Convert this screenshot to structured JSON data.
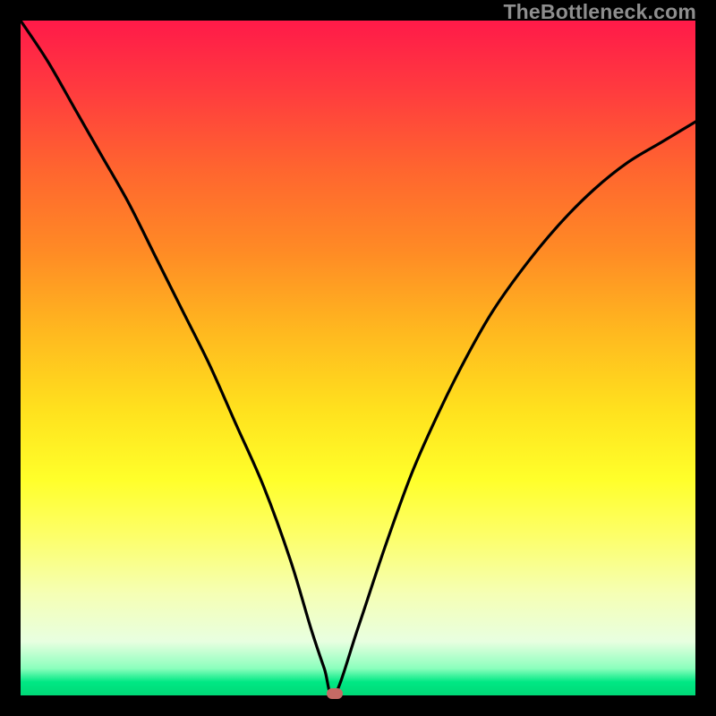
{
  "watermark": "TheBottleneck.com",
  "colors": {
    "frame": "#000000",
    "gradient_top": "#ff1a49",
    "gradient_bottom": "#00d877",
    "curve": "#000000",
    "marker": "#c56a65",
    "watermark": "#8e8e8e"
  },
  "chart_data": {
    "type": "line",
    "title": "",
    "xlabel": "",
    "ylabel": "",
    "xlim": [
      0,
      100
    ],
    "ylim": [
      0,
      100
    ],
    "grid": false,
    "legend": false,
    "series": [
      {
        "name": "bottleneck-curve",
        "x": [
          0,
          4,
          8,
          12,
          16,
          20,
          24,
          28,
          32,
          36,
          40,
          43,
          45,
          46.5,
          50,
          54,
          58,
          62,
          66,
          70,
          75,
          80,
          85,
          90,
          95,
          100
        ],
        "values": [
          100,
          94,
          87,
          80,
          73,
          65,
          57,
          49,
          40,
          31,
          20,
          10,
          4,
          0,
          10,
          22,
          33,
          42,
          50,
          57,
          64,
          70,
          75,
          79,
          82,
          85
        ]
      }
    ],
    "annotations": [
      {
        "name": "min-point-marker",
        "x": 46.5,
        "y": 0
      }
    ]
  }
}
